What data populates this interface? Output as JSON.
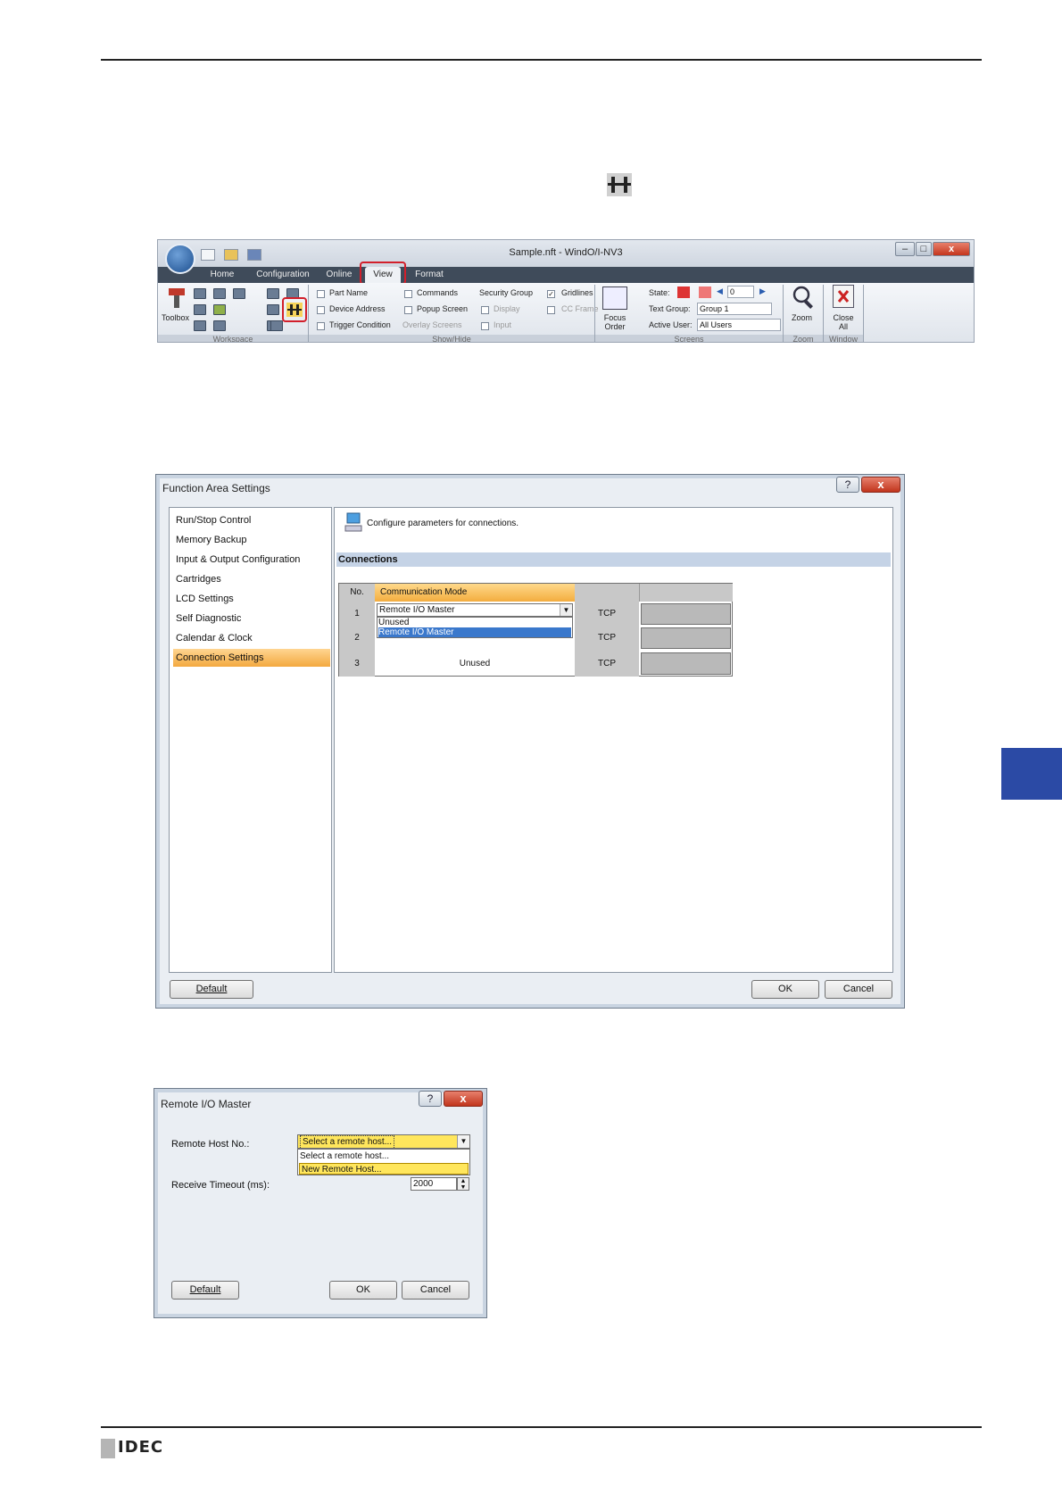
{
  "ribbon": {
    "window_title": "Sample.nft - WindO/I-NV3",
    "tabs": [
      "Home",
      "Configuration",
      "Online",
      "View",
      "Format"
    ],
    "groups": {
      "workspace": {
        "label": "Workspace",
        "toolbox": "Toolbox"
      },
      "show_hide": {
        "label": "Show/Hide",
        "col1": [
          "Part Name",
          "Device Address",
          "Trigger Condition"
        ],
        "col2": [
          "Commands",
          "Popup Screen",
          "Overlay Screens"
        ],
        "col3_head": "Security Group",
        "col3": [
          "Display",
          "Input"
        ],
        "col4": [
          "Gridlines",
          "CC Frame"
        ]
      },
      "screens": {
        "label": "Screens",
        "focus_order": "Focus Order",
        "state_label": "State:",
        "state_value": "0",
        "text_group_label": "Text Group:",
        "text_group_value": "Group 1",
        "active_user_label": "Active User:",
        "active_user_value": "All Users"
      },
      "zoom": {
        "label": "Zoom",
        "button": "Zoom"
      },
      "window": {
        "label": "Window",
        "button": "Close All"
      }
    }
  },
  "function_area": {
    "title": "Function Area Settings",
    "help": "?",
    "close": "x",
    "nav": [
      "Run/Stop Control",
      "Memory Backup",
      "Input & Output Configuration",
      "Cartridges",
      "LCD Settings",
      "Self Diagnostic",
      "Calendar & Clock",
      "Connection Settings"
    ],
    "selected_nav": "Connection Settings",
    "description": "Configure parameters for connections.",
    "section": "Connections",
    "table": {
      "headers": [
        "No.",
        "Communication Mode",
        "",
        ""
      ],
      "rows": [
        {
          "no": "1",
          "mode": "Remote I/O Master",
          "proto": "TCP"
        },
        {
          "no": "2",
          "mode": "",
          "proto": "TCP"
        },
        {
          "no": "3",
          "mode": "Unused",
          "proto": "TCP"
        }
      ],
      "dropdown_options": [
        "Unused",
        "Remote I/O Master"
      ],
      "dropdown_selected": "Remote I/O Master"
    },
    "buttons": {
      "default": "Default",
      "ok": "OK",
      "cancel": "Cancel"
    }
  },
  "remote_io": {
    "title": "Remote I/O Master",
    "help": "?",
    "close": "x",
    "host_label": "Remote Host No.:",
    "host_value": "Select a remote host...",
    "host_options": [
      "Select a remote host...",
      "New Remote Host..."
    ],
    "host_highlighted": "New Remote Host...",
    "timeout_label": "Receive Timeout (ms):",
    "timeout_value": "2000",
    "buttons": {
      "default": "Default",
      "ok": "OK",
      "cancel": "Cancel"
    }
  },
  "footer": {
    "logo": "IDEC"
  },
  "colors": {
    "accent_blue": "#2b4aa5",
    "selection_orange": "#f3a940",
    "highlight_red": "#d21f2b"
  }
}
